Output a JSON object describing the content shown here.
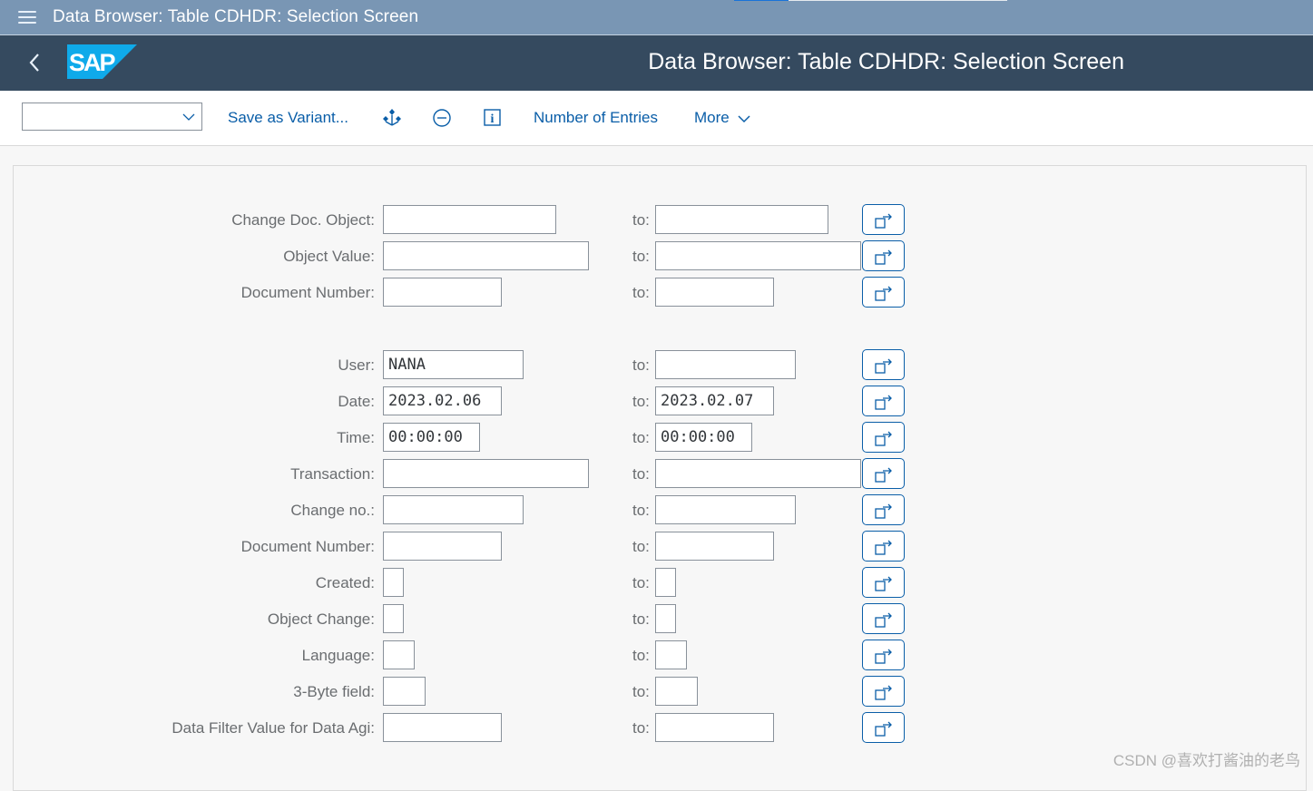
{
  "window": {
    "title": "Data Browser: Table CDHDR: Selection Screen",
    "menu_icon": "hamburger-icon"
  },
  "shell": {
    "back_icon": "chevron-left-icon",
    "logo_text": "SAP",
    "page_title": "Data Browser: Table CDHDR: Selection Screen",
    "colors": {
      "shell_bg": "#354a5f",
      "titlebar_bg": "#7996b4",
      "logo_blue": "#0faaea"
    }
  },
  "toolbar": {
    "variant_select": {
      "value": "",
      "icon": "chevron-down-icon"
    },
    "save_variant_label": "Save as Variant...",
    "icons": [
      "hierarchy-icon",
      "minus-circle-icon",
      "info-icon"
    ],
    "number_of_entries_label": "Number of Entries",
    "more_label": "More",
    "link_color": "#0a5ea8"
  },
  "form": {
    "to_label": "to:",
    "multiple_selection_icon": "multiple-selection-icon",
    "fields": [
      {
        "label": "Change Doc. Object:",
        "from": "",
        "to": ""
      },
      {
        "label": "Object Value:",
        "from": "",
        "to": ""
      },
      {
        "label": "Document Number:",
        "from": "",
        "to": ""
      },
      {
        "label": "User:",
        "from": "NANA",
        "to": ""
      },
      {
        "label": "Date:",
        "from": "2023.02.06",
        "to": "2023.02.07"
      },
      {
        "label": "Time:",
        "from": "00:00:00",
        "to": "00:00:00"
      },
      {
        "label": "Transaction:",
        "from": "",
        "to": ""
      },
      {
        "label": "Change no.:",
        "from": "",
        "to": ""
      },
      {
        "label": "Document Number:",
        "from": "",
        "to": ""
      },
      {
        "label": "Created:",
        "from": "",
        "to": ""
      },
      {
        "label": "Object Change:",
        "from": "",
        "to": ""
      },
      {
        "label": "Language:",
        "from": "",
        "to": ""
      },
      {
        "label": "3-Byte field:",
        "from": "",
        "to": ""
      },
      {
        "label": "Data Filter Value for Data Agi:",
        "from": "",
        "to": ""
      }
    ]
  },
  "watermark": "CSDN @喜欢打酱油的老鸟"
}
